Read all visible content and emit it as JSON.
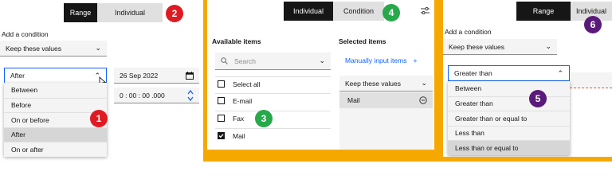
{
  "colors": {
    "orange_frame": "#f5a900",
    "red_badge": "#e01a22",
    "green_badge": "#27a84a",
    "purple_badge": "#5a1a7a",
    "link_blue": "#0f62fe",
    "dark": "#161616"
  },
  "panel1": {
    "segment": {
      "range": "Range",
      "individual": "Individual"
    },
    "badge_number": "2",
    "add_condition": "Add a condition",
    "keep_select": "Keep these values",
    "operator_select": "After",
    "date_value": "26 Sep 2022",
    "time_value": "0 : 00 : 00 .000",
    "menu_items": [
      "Between",
      "Before",
      "On or before",
      "After",
      "On or after"
    ],
    "menu_badge": "1",
    "icons": [
      "chevron-down-icon",
      "chevron-up-icon",
      "calendar-icon",
      "stepper-icon",
      "mouse-cursor-icon"
    ]
  },
  "panel2": {
    "segment": {
      "individual": "Individual",
      "condition": "Condition"
    },
    "badge_number": "4",
    "available_items": "Available items",
    "selected_items": "Selected items",
    "search_placeholder": "Search",
    "manual_input": "Manually input items",
    "manual_plus": "+",
    "keep_select": "Keep these values",
    "items": [
      {
        "label": "Select all",
        "checked": false
      },
      {
        "label": "E-mail",
        "checked": false
      },
      {
        "label": "Fax",
        "checked": false
      },
      {
        "label": "Mail",
        "checked": true
      }
    ],
    "selected_item": "Mail",
    "list_badge": "3",
    "icons": [
      "settings-icon",
      "search-icon",
      "remove-icon"
    ]
  },
  "panel3": {
    "segment": {
      "range": "Range",
      "individual": "Individual"
    },
    "badge_number": "6",
    "add_condition": "Add a condition",
    "keep_select": "Keep these values",
    "operator_select": "Greater than",
    "menu_items": [
      "Between",
      "Greater than",
      "Greater than or equal to",
      "Less than",
      "Less than or equal to"
    ],
    "menu_badge": "5"
  }
}
